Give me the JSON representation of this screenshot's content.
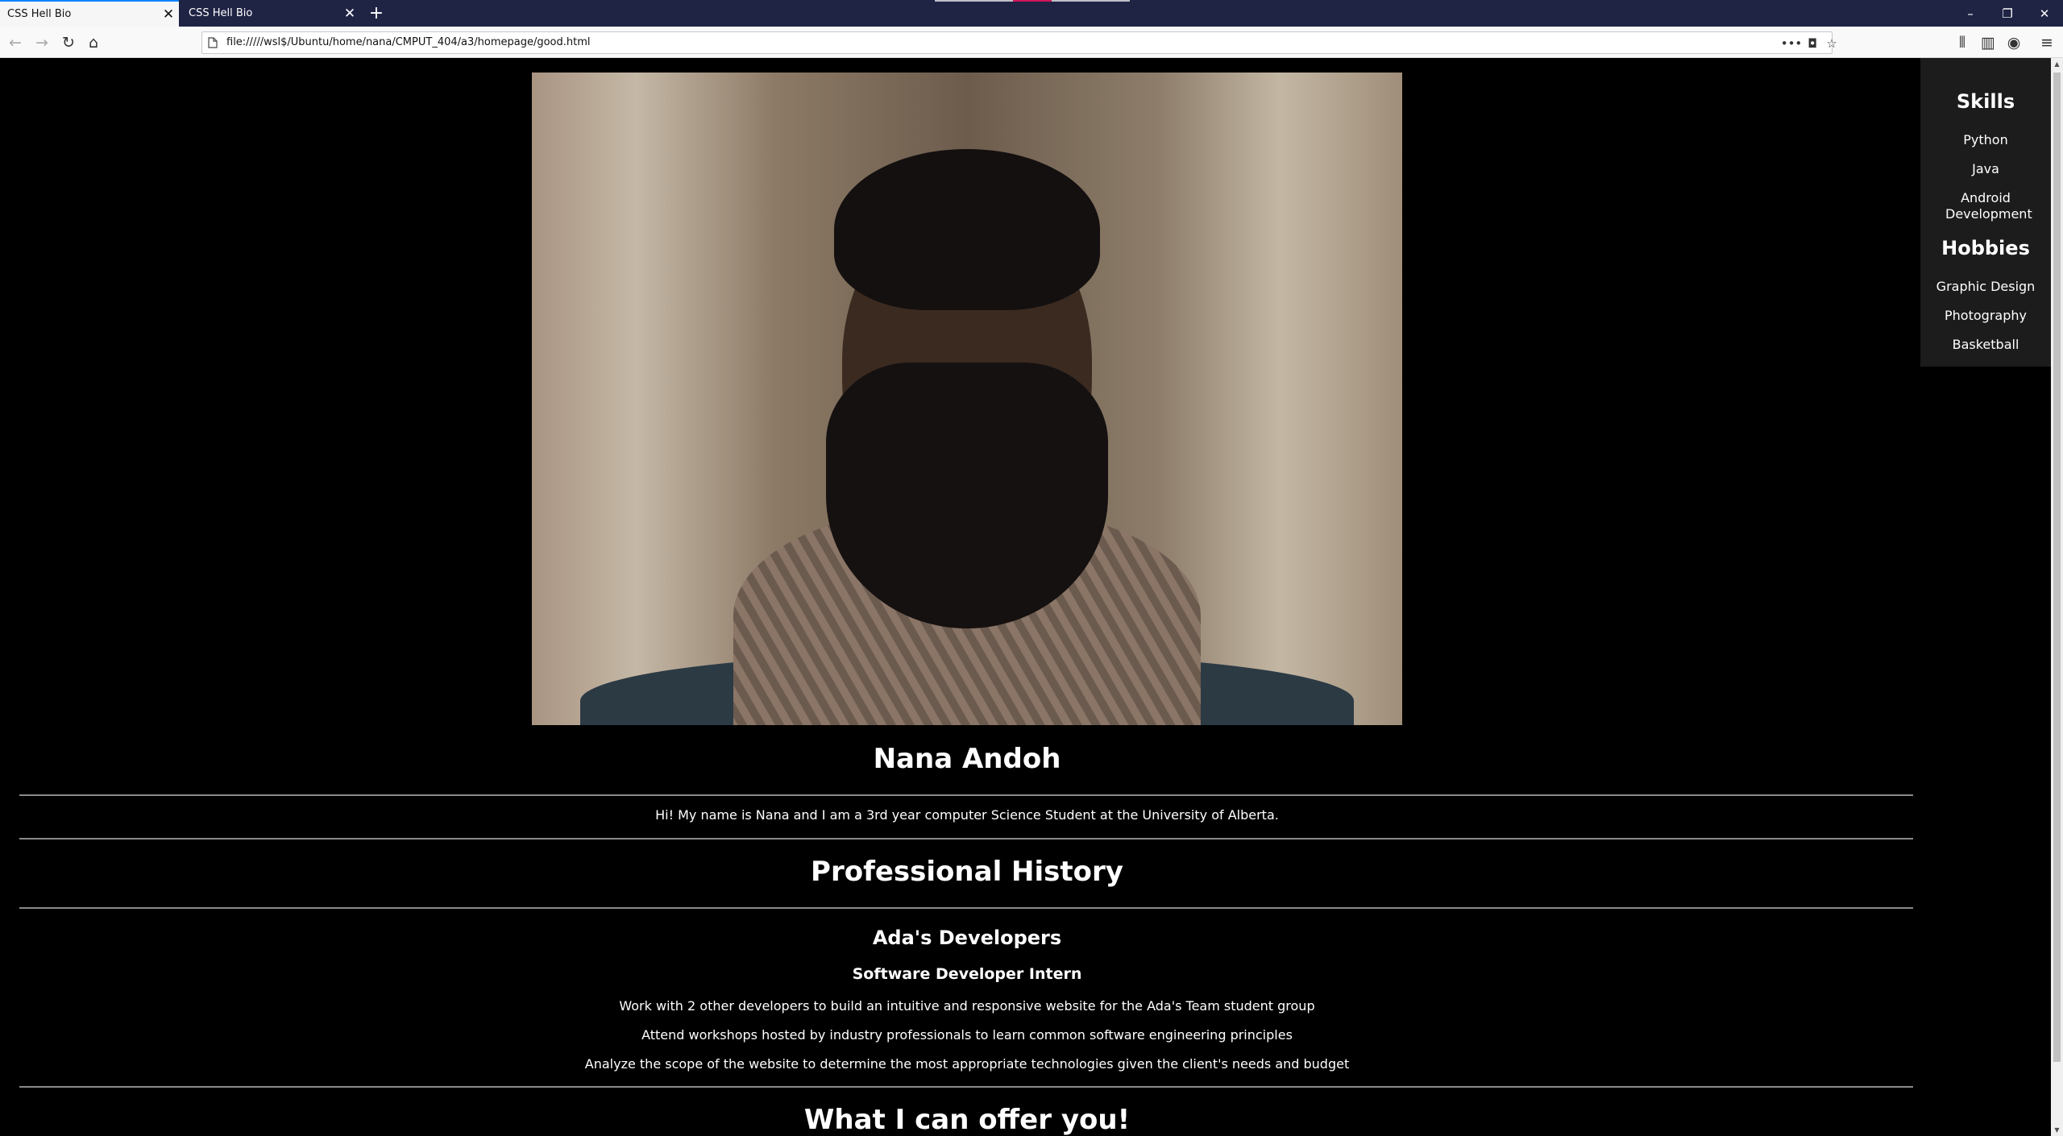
{
  "browser": {
    "tabs": [
      {
        "title": "CSS Hell Bio",
        "active": true
      },
      {
        "title": "CSS Hell Bio",
        "active": false
      }
    ],
    "new_tab_icon": "plus-icon",
    "url": "file://///wsl$/Ubuntu/home/nana/CMPUT_404/a3/homepage/good.html"
  },
  "page": {
    "name": "Nana Andoh",
    "bio": "Hi! My name is Nana and I am a 3rd year computer Science Student at the University of Alberta.",
    "professional_history": {
      "title": "Professional History",
      "company": "Ada's Developers",
      "role": "Software Developer Intern",
      "duties": [
        "Work with 2 other developers to build an intuitive and responsive website for the Ada's Team student group",
        "Attend workshops hosted by industry professionals to learn common software engineering principles",
        "Analyze the scope of the website to determine the most appropriate technologies given the client's needs and budget"
      ]
    },
    "offer_title": "What I can offer you!"
  },
  "sidebar": {
    "skills_title": "Skills",
    "skills": [
      "Python",
      "Java",
      "Android Development"
    ],
    "hobbies_title": "Hobbies",
    "hobbies": [
      "Graphic Design",
      "Photography",
      "Basketball"
    ]
  },
  "colors": {
    "tabbar": "#1f2344",
    "page_background": "#000000",
    "sidebar_background": "#1c1c1c",
    "accent": "#0a84ff"
  }
}
